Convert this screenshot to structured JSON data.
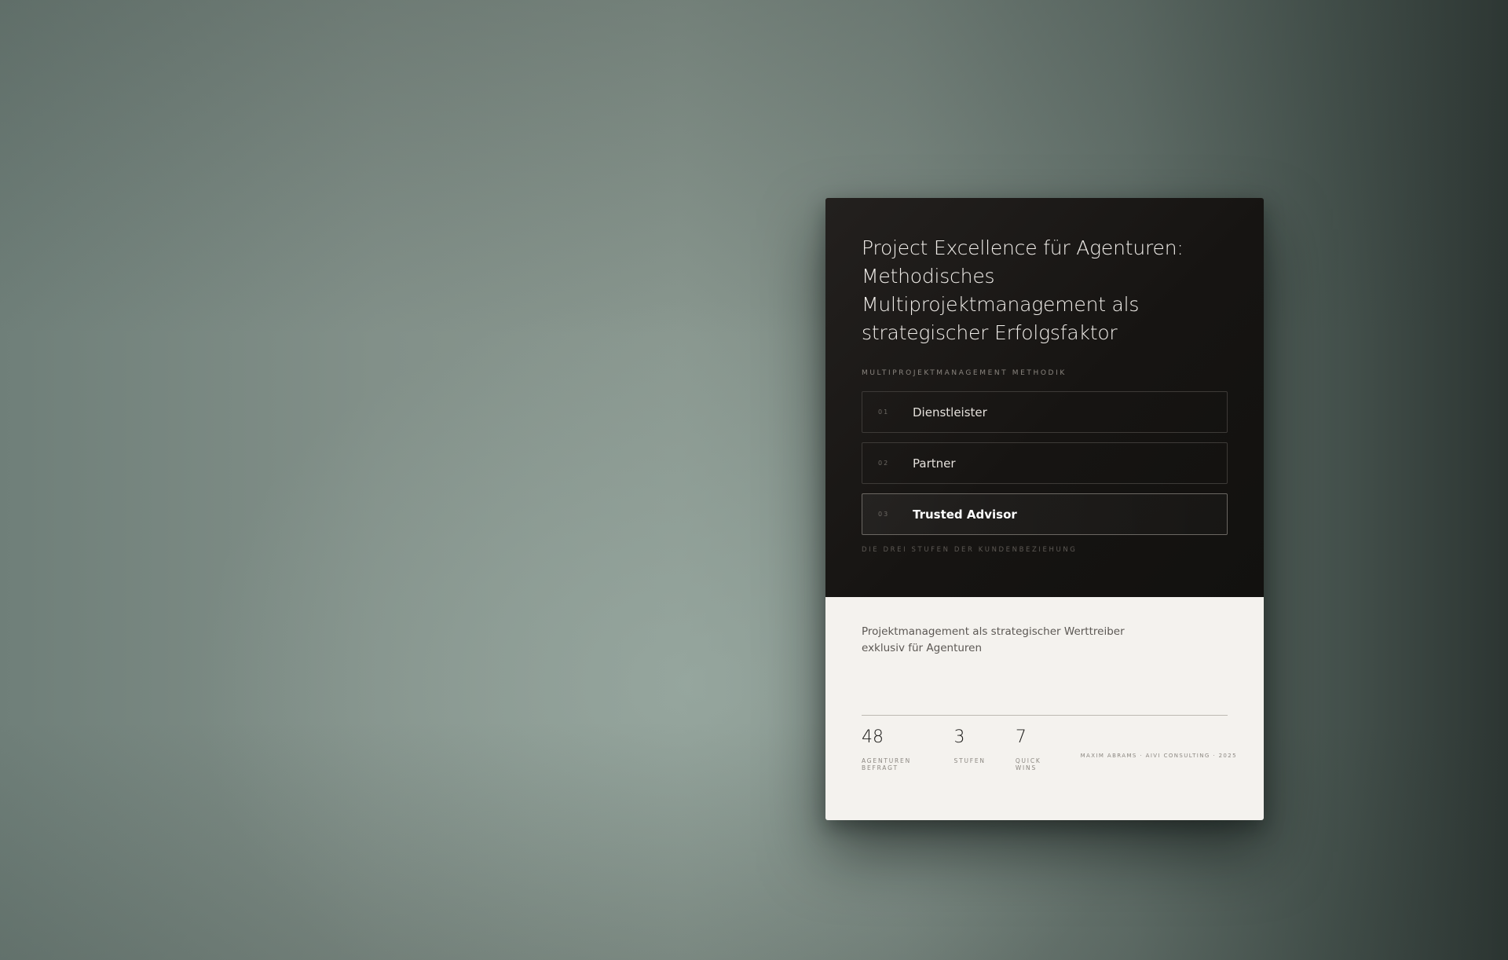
{
  "card": {
    "title": "Project Excellence für Agenturen: Methodisches Multiprojektmanagement als strategischer Erfolgsfaktor",
    "section_label": "Multiprojektmanagement Methodik",
    "stages": [
      {
        "number": "01",
        "label": "Dienstleister",
        "active": false
      },
      {
        "number": "02",
        "label": "Partner",
        "active": false
      },
      {
        "number": "03",
        "label": "Trusted Advisor",
        "active": true
      }
    ],
    "stages_caption": "Die drei Stufen der Kundenbeziehung",
    "subtitle": "Projektmanagement als strategischer Werttreiber exklusiv für Agenturen",
    "stats": [
      {
        "value": "48",
        "label": "Agenturen befragt"
      },
      {
        "value": "3",
        "label": "Stufen"
      },
      {
        "value": "7",
        "label": "Quick Wins"
      }
    ],
    "credit": "Maxim Abrams · AIVI Consulting · 2025"
  },
  "colors": {
    "card_dark": "#161412",
    "card_light": "#f4f2ee",
    "background": "#829089"
  }
}
